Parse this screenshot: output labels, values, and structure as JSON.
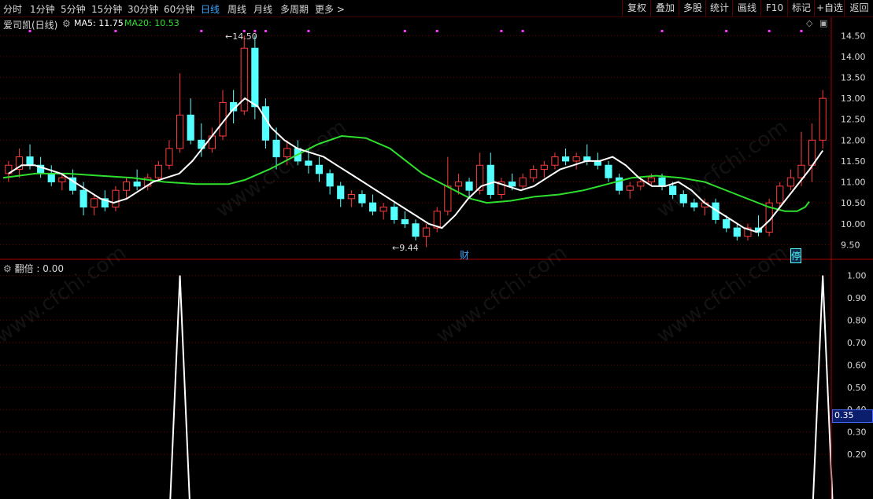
{
  "toolbar": {
    "periods": [
      "分时",
      "1分钟",
      "5分钟",
      "15分钟",
      "30分钟",
      "60分钟",
      "日线",
      "周线",
      "月线",
      "多周期",
      "更多"
    ],
    "active_period": "日线",
    "more_arrow": ">",
    "buttons": [
      "复权",
      "叠加",
      "多股",
      "统计",
      "画线",
      "F10",
      "标记",
      "+自选",
      "返回"
    ]
  },
  "main_panel": {
    "stock_label": "爱司凯(日线)",
    "ma5_label": "MA5: 11.75",
    "ma20_label": "MA20: 10.53",
    "high_marker": "14.50",
    "low_marker": "9.44",
    "event_badges": [
      "财",
      "停"
    ],
    "colors": {
      "up": "#ff3c3c",
      "down": "#54ffff",
      "ma5": "#ffffff",
      "ma20": "#2ee02e",
      "grid": "#6a0000",
      "axis": "#b00000",
      "dots": "#ff33ff"
    }
  },
  "indicator_panel": {
    "label": "翻倍 : 0.00",
    "cursor_value": "0.35"
  },
  "watermark": "www.cfchi.com",
  "chart_data": [
    {
      "type": "candlestick",
      "title": "爱司凯(日线)",
      "y_ticks": [
        "9.50",
        "10.00",
        "10.50",
        "11.00",
        "11.50",
        "12.00",
        "12.50",
        "13.00",
        "13.50",
        "14.00",
        "14.50"
      ],
      "ylim": [
        9.3,
        14.75
      ],
      "grid": true,
      "candles": [
        {
          "o": 11.2,
          "h": 11.5,
          "l": 11.0,
          "c": 11.4
        },
        {
          "o": 11.3,
          "h": 11.8,
          "l": 11.1,
          "c": 11.6
        },
        {
          "o": 11.6,
          "h": 11.9,
          "l": 11.3,
          "c": 11.4
        },
        {
          "o": 11.4,
          "h": 11.6,
          "l": 11.1,
          "c": 11.2
        },
        {
          "o": 11.2,
          "h": 11.4,
          "l": 10.9,
          "c": 11.0
        },
        {
          "o": 11.0,
          "h": 11.2,
          "l": 10.8,
          "c": 11.1
        },
        {
          "o": 11.1,
          "h": 11.3,
          "l": 10.7,
          "c": 10.8
        },
        {
          "o": 10.8,
          "h": 11.0,
          "l": 10.2,
          "c": 10.4
        },
        {
          "o": 10.4,
          "h": 10.7,
          "l": 10.2,
          "c": 10.6
        },
        {
          "o": 10.6,
          "h": 10.8,
          "l": 10.3,
          "c": 10.4
        },
        {
          "o": 10.4,
          "h": 10.9,
          "l": 10.3,
          "c": 10.8
        },
        {
          "o": 10.8,
          "h": 11.1,
          "l": 10.6,
          "c": 11.0
        },
        {
          "o": 11.0,
          "h": 11.3,
          "l": 10.8,
          "c": 10.9
        },
        {
          "o": 10.9,
          "h": 11.2,
          "l": 10.8,
          "c": 11.1
        },
        {
          "o": 11.1,
          "h": 11.5,
          "l": 11.0,
          "c": 11.4
        },
        {
          "o": 11.4,
          "h": 12.0,
          "l": 11.3,
          "c": 11.8
        },
        {
          "o": 11.8,
          "h": 13.6,
          "l": 11.7,
          "c": 12.6
        },
        {
          "o": 12.6,
          "h": 13.0,
          "l": 11.9,
          "c": 12.0
        },
        {
          "o": 12.0,
          "h": 12.4,
          "l": 11.6,
          "c": 11.8
        },
        {
          "o": 11.8,
          "h": 12.3,
          "l": 11.7,
          "c": 12.1
        },
        {
          "o": 12.1,
          "h": 13.2,
          "l": 12.0,
          "c": 12.9
        },
        {
          "o": 12.9,
          "h": 13.2,
          "l": 12.4,
          "c": 12.7
        },
        {
          "o": 12.7,
          "h": 14.5,
          "l": 12.6,
          "c": 14.2
        },
        {
          "o": 14.2,
          "h": 14.5,
          "l": 12.5,
          "c": 12.8
        },
        {
          "o": 12.8,
          "h": 13.0,
          "l": 11.8,
          "c": 12.0
        },
        {
          "o": 12.0,
          "h": 12.3,
          "l": 11.3,
          "c": 11.6
        },
        {
          "o": 11.6,
          "h": 12.0,
          "l": 11.4,
          "c": 11.8
        },
        {
          "o": 11.8,
          "h": 12.0,
          "l": 11.4,
          "c": 11.5
        },
        {
          "o": 11.5,
          "h": 11.8,
          "l": 11.2,
          "c": 11.4
        },
        {
          "o": 11.4,
          "h": 11.6,
          "l": 11.0,
          "c": 11.2
        },
        {
          "o": 11.2,
          "h": 11.3,
          "l": 10.7,
          "c": 10.9
        },
        {
          "o": 10.9,
          "h": 11.0,
          "l": 10.4,
          "c": 10.6
        },
        {
          "o": 10.6,
          "h": 10.8,
          "l": 10.4,
          "c": 10.7
        },
        {
          "o": 10.7,
          "h": 10.8,
          "l": 10.4,
          "c": 10.5
        },
        {
          "o": 10.5,
          "h": 10.7,
          "l": 10.2,
          "c": 10.3
        },
        {
          "o": 10.3,
          "h": 10.5,
          "l": 10.1,
          "c": 10.4
        },
        {
          "o": 10.4,
          "h": 10.5,
          "l": 10.0,
          "c": 10.1
        },
        {
          "o": 10.1,
          "h": 10.3,
          "l": 9.9,
          "c": 10.0
        },
        {
          "o": 10.0,
          "h": 10.1,
          "l": 9.6,
          "c": 9.7
        },
        {
          "o": 9.7,
          "h": 10.0,
          "l": 9.44,
          "c": 9.9
        },
        {
          "o": 9.9,
          "h": 10.4,
          "l": 9.8,
          "c": 10.3
        },
        {
          "o": 10.3,
          "h": 11.6,
          "l": 10.2,
          "c": 10.9
        },
        {
          "o": 10.9,
          "h": 11.2,
          "l": 10.7,
          "c": 11.0
        },
        {
          "o": 11.0,
          "h": 11.1,
          "l": 10.6,
          "c": 10.8
        },
        {
          "o": 10.8,
          "h": 11.7,
          "l": 10.7,
          "c": 11.4
        },
        {
          "o": 11.4,
          "h": 11.7,
          "l": 10.6,
          "c": 10.7
        },
        {
          "o": 10.7,
          "h": 11.1,
          "l": 10.6,
          "c": 11.0
        },
        {
          "o": 11.0,
          "h": 11.2,
          "l": 10.8,
          "c": 10.9
        },
        {
          "o": 10.9,
          "h": 11.2,
          "l": 10.8,
          "c": 11.1
        },
        {
          "o": 11.1,
          "h": 11.4,
          "l": 11.0,
          "c": 11.3
        },
        {
          "o": 11.3,
          "h": 11.5,
          "l": 11.1,
          "c": 11.4
        },
        {
          "o": 11.4,
          "h": 11.7,
          "l": 11.3,
          "c": 11.6
        },
        {
          "o": 11.6,
          "h": 11.8,
          "l": 11.4,
          "c": 11.5
        },
        {
          "o": 11.5,
          "h": 11.7,
          "l": 11.3,
          "c": 11.6
        },
        {
          "o": 11.6,
          "h": 11.9,
          "l": 11.4,
          "c": 11.5
        },
        {
          "o": 11.5,
          "h": 11.7,
          "l": 11.3,
          "c": 11.4
        },
        {
          "o": 11.4,
          "h": 11.5,
          "l": 11.0,
          "c": 11.1
        },
        {
          "o": 11.1,
          "h": 11.2,
          "l": 10.7,
          "c": 10.8
        },
        {
          "o": 10.8,
          "h": 11.0,
          "l": 10.6,
          "c": 10.9
        },
        {
          "o": 10.9,
          "h": 11.1,
          "l": 10.8,
          "c": 11.0
        },
        {
          "o": 11.0,
          "h": 11.2,
          "l": 10.9,
          "c": 11.1
        },
        {
          "o": 11.1,
          "h": 11.2,
          "l": 10.8,
          "c": 10.9
        },
        {
          "o": 10.9,
          "h": 11.0,
          "l": 10.6,
          "c": 10.7
        },
        {
          "o": 10.7,
          "h": 10.8,
          "l": 10.4,
          "c": 10.5
        },
        {
          "o": 10.5,
          "h": 10.6,
          "l": 10.3,
          "c": 10.4
        },
        {
          "o": 10.4,
          "h": 10.6,
          "l": 10.2,
          "c": 10.5
        },
        {
          "o": 10.5,
          "h": 10.6,
          "l": 10.0,
          "c": 10.1
        },
        {
          "o": 10.1,
          "h": 10.2,
          "l": 9.8,
          "c": 9.9
        },
        {
          "o": 9.9,
          "h": 10.0,
          "l": 9.6,
          "c": 9.7
        },
        {
          "o": 9.7,
          "h": 10.0,
          "l": 9.6,
          "c": 9.9
        },
        {
          "o": 9.9,
          "h": 10.2,
          "l": 9.7,
          "c": 9.8
        },
        {
          "o": 9.8,
          "h": 10.6,
          "l": 9.7,
          "c": 10.5
        },
        {
          "o": 10.5,
          "h": 11.0,
          "l": 10.4,
          "c": 10.9
        },
        {
          "o": 10.9,
          "h": 11.3,
          "l": 10.8,
          "c": 11.1
        },
        {
          "o": 11.1,
          "h": 12.2,
          "l": 10.9,
          "c": 11.4
        },
        {
          "o": 11.4,
          "h": 12.4,
          "l": 11.0,
          "c": 12.0
        },
        {
          "o": 12.0,
          "h": 13.2,
          "l": 11.8,
          "c": 13.0
        }
      ],
      "ma5": [
        11.2,
        11.4,
        11.4,
        11.3,
        11.2,
        11.0,
        10.8,
        10.6,
        10.5,
        10.6,
        10.8,
        11.0,
        11.1,
        11.2,
        11.5,
        11.9,
        12.3,
        12.7,
        13.0,
        12.8,
        12.3,
        12.0,
        11.8,
        11.7,
        11.6,
        11.4,
        11.2,
        11.0,
        10.8,
        10.6,
        10.4,
        10.2,
        10.0,
        9.9,
        10.2,
        10.6,
        10.9,
        11.0,
        10.9,
        10.8,
        10.9,
        11.1,
        11.3,
        11.4,
        11.5,
        11.5,
        11.6,
        11.4,
        11.1,
        10.9,
        10.9,
        11.0,
        10.8,
        10.5,
        10.3,
        10.1,
        9.9,
        9.8,
        10.1,
        10.5,
        10.9,
        11.3,
        11.75
      ],
      "ma20": [
        11.1,
        11.2,
        11.2,
        11.15,
        11.1,
        11.0,
        10.95,
        10.95,
        11.05,
        11.3,
        11.6,
        11.9,
        12.1,
        12.05,
        11.8,
        11.5,
        11.2,
        10.9,
        10.6,
        10.5,
        10.55,
        10.65,
        10.7,
        10.8,
        10.95,
        11.1,
        11.15,
        11.1,
        11.0,
        10.85,
        10.7,
        10.55,
        10.4,
        10.3,
        10.3,
        10.4,
        10.53
      ],
      "ma_x": [
        0.0,
        0.04,
        0.08,
        0.12,
        0.16,
        0.2,
        0.24,
        0.28,
        0.3,
        0.33,
        0.36,
        0.39,
        0.42,
        0.45,
        0.48,
        0.5,
        0.52,
        0.55,
        0.58,
        0.6,
        0.63,
        0.66,
        0.69,
        0.72,
        0.75,
        0.78,
        0.81,
        0.84,
        0.87,
        0.89,
        0.91,
        0.93,
        0.95,
        0.97,
        0.985,
        0.995,
        1.0
      ]
    },
    {
      "type": "line",
      "title": "翻倍",
      "y_ticks": [
        "0.20",
        "0.30",
        "0.40",
        "0.50",
        "0.60",
        "0.70",
        "0.80",
        "0.90",
        "1.00"
      ],
      "ylim": [
        0.0,
        1.03
      ],
      "spikes": [
        {
          "bar_index": 16,
          "value": 1.0
        },
        {
          "bar_index": 76,
          "value": 1.0
        }
      ]
    }
  ]
}
